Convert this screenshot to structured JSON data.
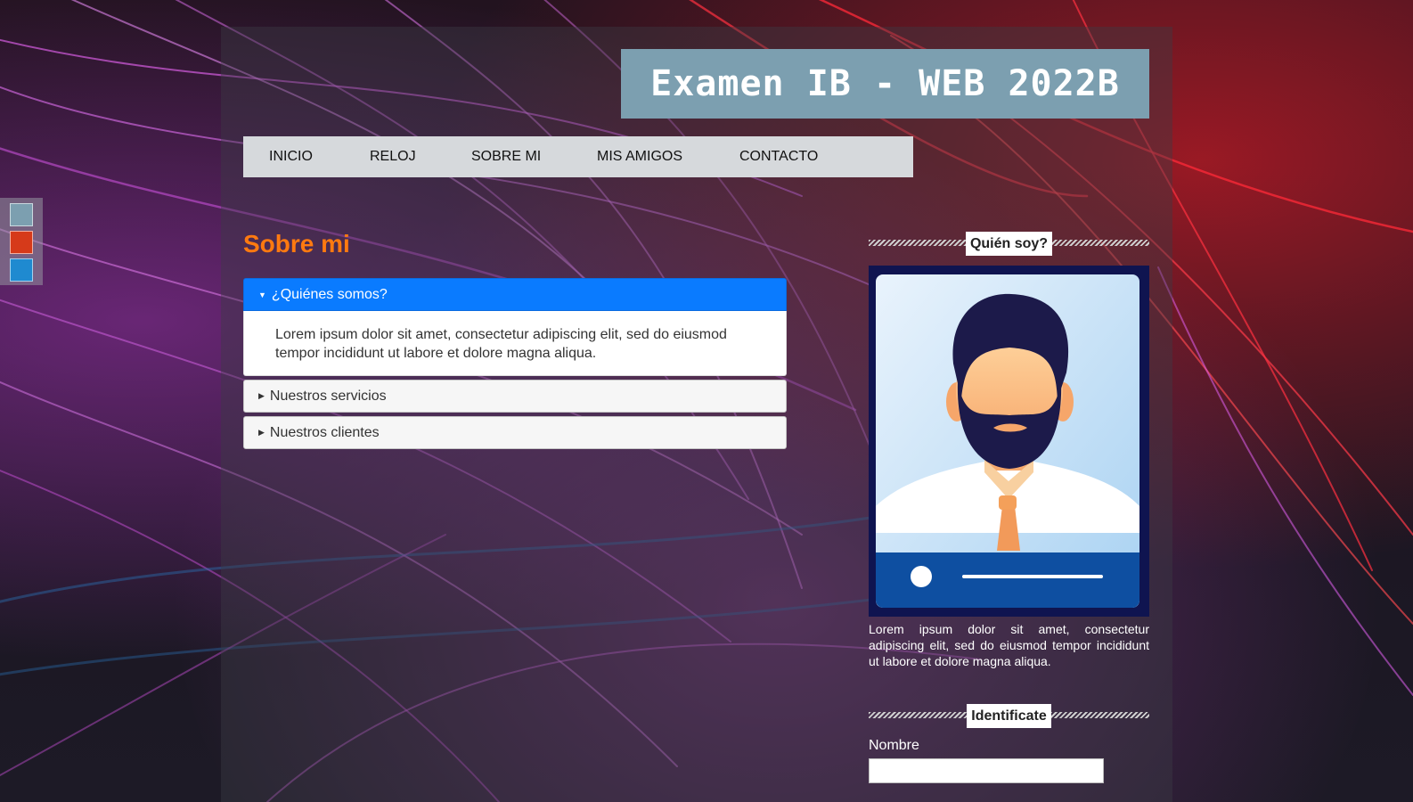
{
  "header": {
    "title": "Examen IB - WEB 2022B"
  },
  "nav": {
    "items": [
      "INICIO",
      "RELOJ",
      "SOBRE MI",
      "MIS AMIGOS",
      "CONTACTO"
    ]
  },
  "theme_swatches": [
    "#7c9fb0",
    "#d63a1a",
    "#1f8ad0"
  ],
  "main": {
    "title": "Sobre mi",
    "accordion": [
      {
        "label": "¿Quiénes somos?",
        "expanded": true,
        "content": "Lorem ipsum dolor sit amet, consectetur adipiscing elit, sed do eiusmod tempor incididunt ut labore et dolore magna aliqua."
      },
      {
        "label": "Nuestros servicios",
        "expanded": false
      },
      {
        "label": "Nuestros clientes",
        "expanded": false
      }
    ]
  },
  "sidebar": {
    "about_heading": "Quién soy?",
    "about_text": "Lorem ipsum dolor sit amet, consectetur adipiscing elit, sed do eiusmod tempor incididunt ut labore et dolore magna aliqua.",
    "form_heading": "Identificate",
    "name_label": "Nombre",
    "name_value": ""
  },
  "colors": {
    "accent": "#0a7bff",
    "title_orange": "#ff7a10",
    "header_bg": "#7c9fb0",
    "nav_bg": "#d6d9dc"
  }
}
